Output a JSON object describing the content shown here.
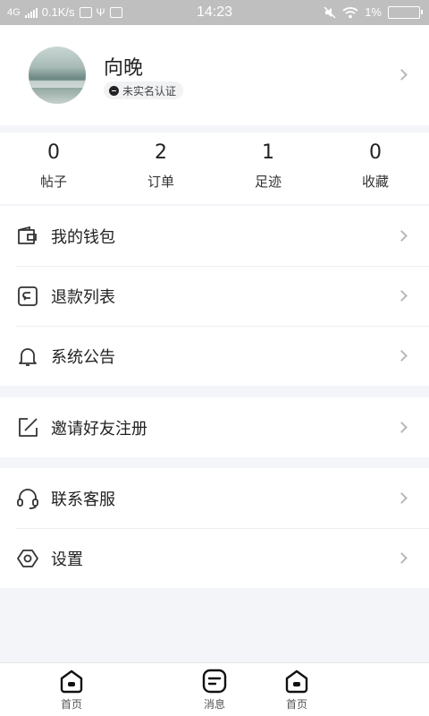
{
  "status_bar": {
    "network_type": "4G",
    "speed": "0.1K/s",
    "time": "14:23",
    "battery": "1%"
  },
  "profile": {
    "name": "向晚",
    "verify_status": "未实名认证"
  },
  "stats": [
    {
      "value": "0",
      "label": "帖子"
    },
    {
      "value": "2",
      "label": "订单"
    },
    {
      "value": "1",
      "label": "足迹"
    },
    {
      "value": "0",
      "label": "收藏"
    }
  ],
  "menu": {
    "wallet": "我的钱包",
    "refunds": "退款列表",
    "announcements": "系统公告",
    "invite": "邀请好友注册",
    "support": "联系客服",
    "settings": "设置"
  },
  "tabs": [
    {
      "label": "首页",
      "icon": "home-icon"
    },
    {
      "label": "消息",
      "icon": "message-icon"
    },
    {
      "label": "首页",
      "icon": "home-icon"
    }
  ],
  "colors": {
    "status_bar": "#bfbfbf",
    "page_bg": "#f4f5f9",
    "text": "#222222",
    "chevron": "#b8b8b8"
  }
}
